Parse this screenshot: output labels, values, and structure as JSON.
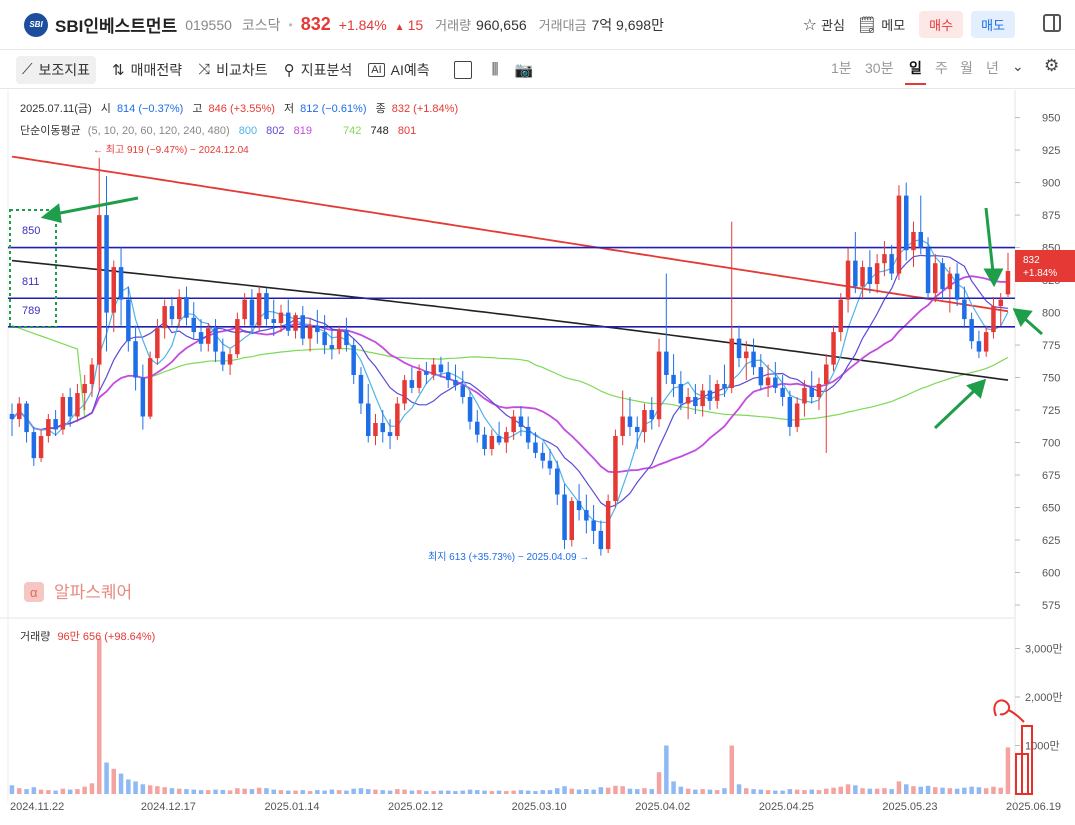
{
  "header": {
    "logo_text": "SBI",
    "name": "SBI인베스트먼트",
    "code": "019550",
    "market": "코스닥",
    "price": "832",
    "change_pct": "+1.84%",
    "change_val": "15",
    "volume_label": "거래량",
    "volume": "960,656",
    "amount_label": "거래대금",
    "amount": "7억 9,698만",
    "watch_label": "관심",
    "memo_label": "메모",
    "buy_label": "매수",
    "sell_label": "매도"
  },
  "toolbar": {
    "items": [
      "보조지표",
      "매매전략",
      "비교차트",
      "지표분석",
      "AI예측"
    ],
    "periods": [
      "1분",
      "30분",
      "일",
      "주",
      "월",
      "년"
    ],
    "active_period": "일"
  },
  "info": {
    "date": "2025.07.11(금)",
    "open_label": "시",
    "open": "814 (−0.37%)",
    "high_label": "고",
    "high": "846 (+3.55%)",
    "low_label": "저",
    "low": "812 (−0.61%)",
    "close_label": "종",
    "close": "832 (+1.84%)",
    "ma_label": "단순이동평균",
    "ma_params": "(5, 10, 20, 60, 120, 240, 480)",
    "ma_values": [
      "800",
      "802",
      "819",
      "742",
      "748",
      "801"
    ],
    "ma_colors": [
      "#4fb3e8",
      "#5b4bd6",
      "#c44be0",
      "#7ed957",
      "#222222",
      "#e53935"
    ]
  },
  "annotations": {
    "high_text": "← 최고 919 (−9.47%) − 2024.12.04",
    "low_text": "최지 613 (+35.73%) − 2025.04.09 →",
    "boxed_levels": [
      "850",
      "811",
      "789"
    ],
    "price_tag_price": "832",
    "price_tag_pct": "+1.84%",
    "watermark": "알파스퀘어"
  },
  "volume_info": {
    "label": "거래량",
    "value": "96만 656 (+98.64%)"
  },
  "chart_data": {
    "type": "candlestick",
    "price_axis_ticks": [
      950,
      925,
      900,
      875,
      850,
      825,
      800,
      775,
      750,
      725,
      700,
      675,
      650,
      625,
      600,
      575
    ],
    "price_range": [
      565,
      962
    ],
    "volume_axis_ticks": [
      "3,000만",
      "2,000만",
      "1000만"
    ],
    "x_tick_labels": [
      "2024.11.22",
      "2024.12.17",
      "2025.01.14",
      "2025.02.12",
      "2025.03.10",
      "2025.04.02",
      "2025.04.25",
      "2025.05.23",
      "2025.06.19"
    ],
    "horizontal_levels": [
      850,
      811,
      789
    ],
    "ma240_endpoints": [
      920,
      801
    ],
    "ma120_endpoints": [
      840,
      748
    ],
    "candles": [
      [
        722,
        730,
        705,
        718,
        180
      ],
      [
        718,
        735,
        712,
        730,
        120
      ],
      [
        730,
        732,
        700,
        708,
        100
      ],
      [
        708,
        712,
        682,
        688,
        140
      ],
      [
        688,
        710,
        685,
        705,
        90
      ],
      [
        705,
        722,
        700,
        718,
        80
      ],
      [
        718,
        725,
        705,
        710,
        70
      ],
      [
        710,
        738,
        706,
        735,
        110
      ],
      [
        735,
        742,
        712,
        720,
        90
      ],
      [
        720,
        745,
        716,
        738,
        100
      ],
      [
        738,
        752,
        725,
        745,
        150
      ],
      [
        745,
        765,
        735,
        760,
        220
      ],
      [
        760,
        919,
        740,
        875,
        3200
      ],
      [
        875,
        905,
        770,
        800,
        650
      ],
      [
        800,
        840,
        785,
        835,
        520
      ],
      [
        835,
        850,
        790,
        810,
        420
      ],
      [
        810,
        820,
        770,
        778,
        300
      ],
      [
        778,
        790,
        740,
        750,
        260
      ],
      [
        750,
        760,
        710,
        720,
        200
      ],
      [
        720,
        770,
        718,
        765,
        180
      ],
      [
        765,
        795,
        760,
        788,
        160
      ],
      [
        788,
        810,
        780,
        805,
        140
      ],
      [
        805,
        812,
        790,
        795,
        120
      ],
      [
        795,
        818,
        788,
        812,
        110
      ],
      [
        812,
        820,
        790,
        796,
        100
      ],
      [
        796,
        808,
        780,
        785,
        90
      ],
      [
        785,
        795,
        770,
        776,
        80
      ],
      [
        776,
        792,
        770,
        788,
        80
      ],
      [
        788,
        795,
        762,
        770,
        90
      ],
      [
        770,
        780,
        755,
        760,
        85
      ],
      [
        760,
        772,
        752,
        768,
        75
      ],
      [
        768,
        800,
        765,
        795,
        120
      ],
      [
        795,
        815,
        790,
        810,
        110
      ],
      [
        810,
        818,
        785,
        790,
        100
      ],
      [
        790,
        820,
        786,
        815,
        130
      ],
      [
        815,
        819,
        790,
        795,
        120
      ],
      [
        795,
        810,
        782,
        792,
        90
      ],
      [
        792,
        806,
        785,
        800,
        80
      ],
      [
        800,
        810,
        782,
        786,
        70
      ],
      [
        786,
        800,
        780,
        798,
        70
      ],
      [
        798,
        805,
        775,
        780,
        80
      ],
      [
        780,
        795,
        770,
        790,
        60
      ],
      [
        790,
        802,
        776,
        785,
        80
      ],
      [
        785,
        798,
        768,
        775,
        70
      ],
      [
        775,
        788,
        764,
        772,
        90
      ],
      [
        772,
        790,
        768,
        786,
        80
      ],
      [
        786,
        796,
        770,
        775,
        70
      ],
      [
        775,
        780,
        745,
        752,
        110
      ],
      [
        752,
        758,
        722,
        730,
        120
      ],
      [
        730,
        745,
        700,
        705,
        100
      ],
      [
        705,
        722,
        698,
        715,
        90
      ],
      [
        715,
        725,
        700,
        708,
        80
      ],
      [
        708,
        718,
        695,
        705,
        70
      ],
      [
        705,
        735,
        702,
        730,
        100
      ],
      [
        730,
        752,
        725,
        748,
        90
      ],
      [
        748,
        758,
        738,
        742,
        70
      ],
      [
        742,
        760,
        738,
        755,
        80
      ],
      [
        755,
        762,
        745,
        752,
        60
      ],
      [
        752,
        765,
        748,
        760,
        60
      ],
      [
        760,
        766,
        750,
        754,
        70
      ],
      [
        754,
        762,
        742,
        748,
        70
      ],
      [
        748,
        760,
        740,
        744,
        60
      ],
      [
        744,
        755,
        730,
        735,
        70
      ],
      [
        735,
        740,
        710,
        716,
        90
      ],
      [
        716,
        725,
        700,
        706,
        80
      ],
      [
        706,
        712,
        690,
        695,
        70
      ],
      [
        695,
        710,
        690,
        705,
        60
      ],
      [
        705,
        716,
        698,
        700,
        70
      ],
      [
        700,
        712,
        692,
        708,
        60
      ],
      [
        708,
        725,
        702,
        720,
        70
      ],
      [
        720,
        728,
        705,
        712,
        80
      ],
      [
        712,
        720,
        695,
        700,
        70
      ],
      [
        700,
        708,
        688,
        692,
        60
      ],
      [
        692,
        700,
        680,
        686,
        80
      ],
      [
        686,
        695,
        675,
        680,
        80
      ],
      [
        680,
        686,
        652,
        660,
        120
      ],
      [
        660,
        668,
        618,
        625,
        160
      ],
      [
        625,
        658,
        620,
        655,
        110
      ],
      [
        655,
        668,
        640,
        648,
        90
      ],
      [
        648,
        660,
        630,
        640,
        100
      ],
      [
        640,
        652,
        622,
        632,
        90
      ],
      [
        632,
        640,
        613,
        618,
        140
      ],
      [
        618,
        660,
        615,
        655,
        130
      ],
      [
        655,
        710,
        650,
        705,
        170
      ],
      [
        705,
        740,
        698,
        720,
        160
      ],
      [
        720,
        735,
        705,
        712,
        110
      ],
      [
        712,
        720,
        695,
        708,
        100
      ],
      [
        708,
        730,
        700,
        725,
        120
      ],
      [
        725,
        735,
        710,
        718,
        100
      ],
      [
        718,
        780,
        712,
        770,
        450
      ],
      [
        770,
        830,
        745,
        752,
        1000
      ],
      [
        752,
        768,
        735,
        745,
        260
      ],
      [
        745,
        755,
        725,
        730,
        150
      ],
      [
        730,
        742,
        718,
        735,
        110
      ],
      [
        735,
        745,
        722,
        728,
        90
      ],
      [
        728,
        745,
        720,
        740,
        100
      ],
      [
        740,
        752,
        725,
        732,
        90
      ],
      [
        732,
        748,
        726,
        745,
        80
      ],
      [
        745,
        760,
        735,
        742,
        120
      ],
      [
        742,
        870,
        738,
        780,
        1000
      ],
      [
        780,
        790,
        758,
        765,
        200
      ],
      [
        765,
        778,
        748,
        770,
        120
      ],
      [
        770,
        780,
        752,
        758,
        100
      ],
      [
        758,
        768,
        740,
        744,
        90
      ],
      [
        744,
        760,
        735,
        750,
        80
      ],
      [
        750,
        762,
        738,
        742,
        70
      ],
      [
        742,
        752,
        728,
        735,
        70
      ],
      [
        735,
        740,
        705,
        712,
        100
      ],
      [
        712,
        735,
        708,
        730,
        90
      ],
      [
        730,
        748,
        720,
        742,
        80
      ],
      [
        742,
        755,
        730,
        735,
        90
      ],
      [
        735,
        750,
        725,
        745,
        80
      ],
      [
        745,
        768,
        692,
        760,
        110
      ],
      [
        760,
        790,
        755,
        785,
        130
      ],
      [
        785,
        815,
        778,
        810,
        150
      ],
      [
        810,
        850,
        800,
        840,
        200
      ],
      [
        840,
        862,
        815,
        820,
        180
      ],
      [
        820,
        840,
        810,
        835,
        120
      ],
      [
        835,
        848,
        815,
        822,
        110
      ],
      [
        822,
        845,
        815,
        838,
        110
      ],
      [
        838,
        855,
        828,
        845,
        120
      ],
      [
        845,
        852,
        825,
        830,
        100
      ],
      [
        830,
        898,
        825,
        890,
        260
      ],
      [
        890,
        900,
        840,
        848,
        200
      ],
      [
        848,
        870,
        835,
        862,
        160
      ],
      [
        862,
        890,
        845,
        850,
        150
      ],
      [
        850,
        858,
        810,
        815,
        170
      ],
      [
        815,
        845,
        808,
        838,
        140
      ],
      [
        838,
        842,
        810,
        818,
        130
      ],
      [
        818,
        835,
        800,
        830,
        120
      ],
      [
        830,
        838,
        805,
        810,
        110
      ],
      [
        810,
        820,
        788,
        795,
        130
      ],
      [
        795,
        800,
        772,
        778,
        150
      ],
      [
        778,
        786,
        765,
        770,
        140
      ],
      [
        770,
        790,
        766,
        785,
        120
      ],
      [
        785,
        812,
        780,
        805,
        150
      ],
      [
        805,
        815,
        790,
        810,
        130
      ],
      [
        814,
        846,
        812,
        832,
        960
      ]
    ]
  }
}
